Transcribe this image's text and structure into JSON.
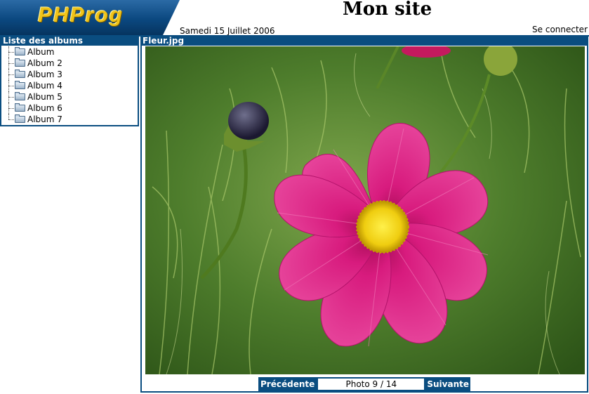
{
  "header": {
    "logo_text": "PHProg",
    "site_title": "Mon site",
    "date": "Samedi 15 Juillet 2006",
    "login_link": "Se connecter"
  },
  "sidebar": {
    "title": "Liste des albums",
    "albums": [
      "Album",
      "Album 2",
      "Album 3",
      "Album 4",
      "Album 5",
      "Album 6",
      "Album 7"
    ]
  },
  "main": {
    "photo_title": "Fleur.jpg",
    "photo_description": "Pink cosmos flower with yellow center and a dark bud on green foliage",
    "nav": {
      "previous_label": "Précédente",
      "counter": "Photo 9 / 14",
      "next_label": "Suivante"
    }
  },
  "colors": {
    "accent": "#0a4d80",
    "logo_text": "#f0c419",
    "flower": "#d8177a",
    "flower_center": "#f2d214"
  }
}
